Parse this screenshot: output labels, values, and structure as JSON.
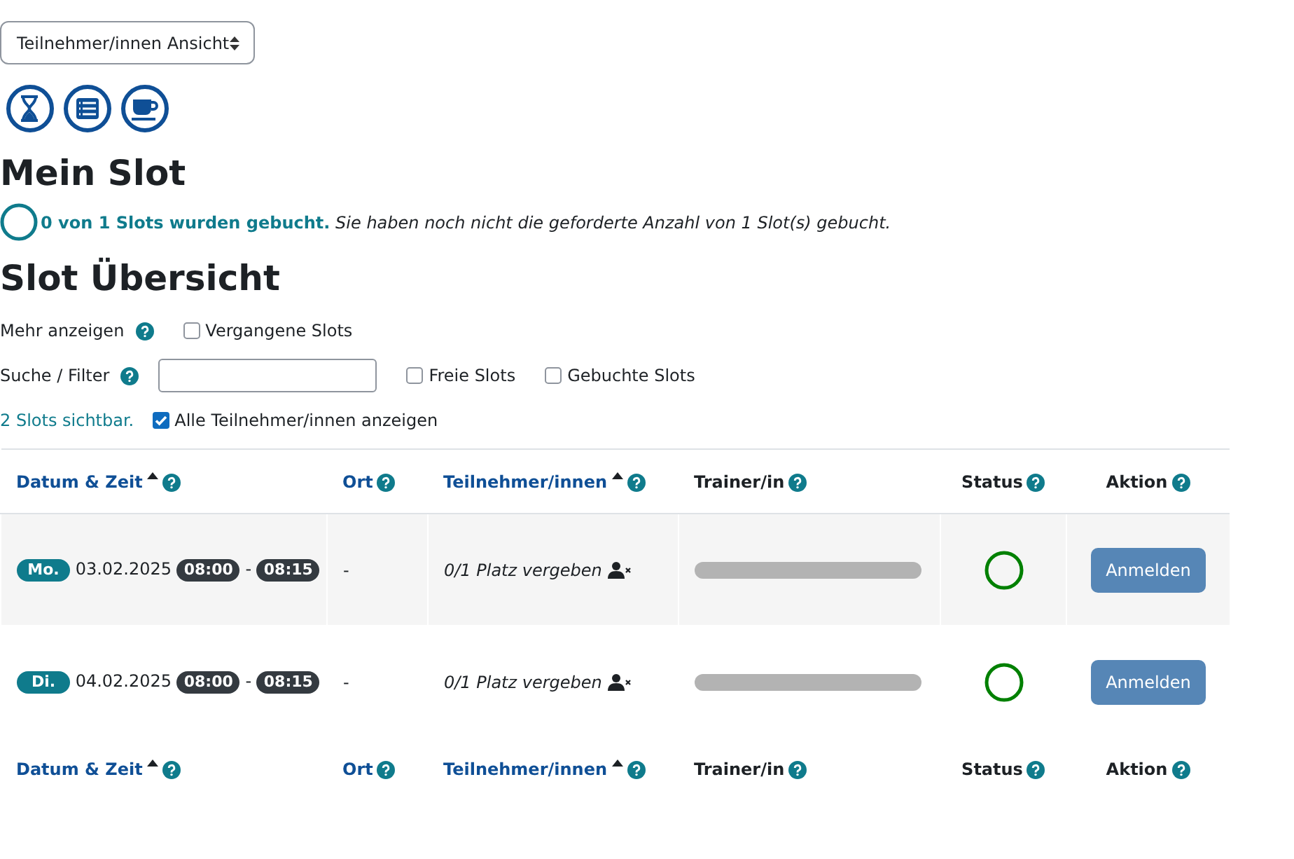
{
  "view_select": {
    "value": "Teilnehmer/innen Ansicht"
  },
  "toolbar": [
    {
      "kind": "hourglass"
    },
    {
      "kind": "list"
    },
    {
      "kind": "cup"
    }
  ],
  "my_slot": {
    "heading": "Mein Slot",
    "booked": false,
    "message": "**0 von 1 Slots wurden gebucht.** *Sie haben noch nicht die geforderte Anzahl von 1 Slot(s) gebucht.*"
  },
  "overview": {
    "heading": "Slot Übersicht",
    "show_more": {
      "label": "Mehr anzeigen",
      "options": [
        {
          "label": "Vergangene Slots",
          "checked": false
        }
      ]
    },
    "filter": {
      "label": "Suche / Filter",
      "options": [
        {
          "label": "Freie Slots",
          "checked": false
        },
        {
          "label": "Gebuchte Slots",
          "checked": false
        }
      ]
    },
    "visible_count": "2 Slots sichtbar.",
    "all_participants": {
      "label": "Alle Teilnehmer/innen anzeigen",
      "checked": true
    }
  },
  "table": {
    "columns": [
      {
        "label": "Datum & Zeit",
        "link": true,
        "sorted": true
      },
      {
        "label": "Ort",
        "link": true,
        "sorted": false
      },
      {
        "label": "Teilnehmer/innen",
        "link": true,
        "sorted": true
      },
      {
        "label": "Trainer/in",
        "link": false
      },
      {
        "label": "Status",
        "link": false
      },
      {
        "label": "Aktion",
        "link": false
      }
    ],
    "footer_columns": [
      {
        "label": "Datum & Zeit",
        "link": true,
        "sorted": true
      },
      {
        "label": "Ort",
        "link": true,
        "sorted": false
      },
      {
        "label": "Teilnehmer/innen",
        "link": true,
        "sorted": true
      },
      {
        "label": "Trainer/in",
        "link": false
      },
      {
        "label": "Status",
        "link": false
      },
      {
        "label": "Aktion",
        "link": false
      }
    ],
    "rows": [
      {
        "day": "Mo.",
        "date": "03.02.2025",
        "start": "08:00",
        "separator": "-",
        "end": "08:15",
        "location": "-",
        "participants": "0/1 Platz vergeben",
        "booked": false,
        "action": "Anmelden"
      },
      {
        "day": "Di.",
        "date": "04.02.2025",
        "start": "08:00",
        "separator": "-",
        "end": "08:15",
        "location": "-",
        "participants": "0/1 Platz vergeben",
        "booked": false,
        "action": "Anmelden"
      }
    ]
  }
}
